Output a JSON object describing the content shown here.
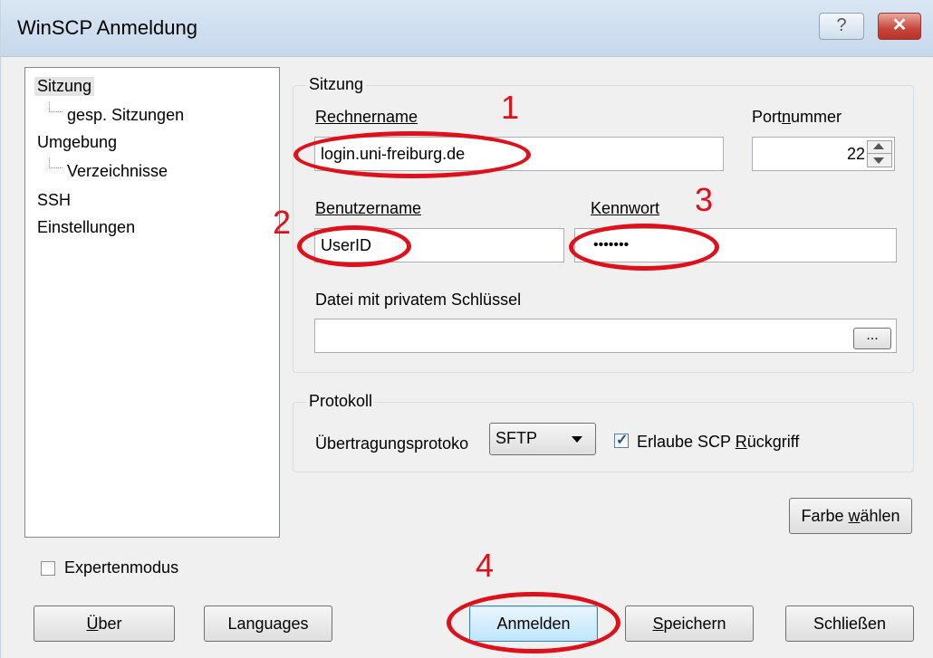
{
  "window": {
    "title": "WinSCP Anmeldung",
    "help_label": "?",
    "close_label": "✕"
  },
  "tree": {
    "items": [
      {
        "label": "Sitzung",
        "selected": true
      },
      {
        "label": "gesp. Sitzungen"
      },
      {
        "label": "Umgebung"
      },
      {
        "label": "Verzeichnisse"
      },
      {
        "label": "SSH"
      },
      {
        "label": "Einstellungen"
      }
    ]
  },
  "session": {
    "group_title": "Sitzung",
    "host_label": "Rechnername",
    "host_value": "login.uni-freiburg.de",
    "port_label": "Portnummer",
    "port_value": "22",
    "user_label": "Benutzername",
    "user_value": "UserID",
    "password_label": "Kennwort",
    "password_value": "•••••••",
    "keyfile_label": "Datei mit privatem Schlüssel",
    "keyfile_value": "",
    "browse_label": "..."
  },
  "protocol": {
    "group_title": "Protokoll",
    "transfer_label": "Übertragungsprotoko",
    "transfer_value": "SFTP",
    "scp_fallback_label": "Erlaube SCP Rückgriff",
    "scp_fallback_checked": true
  },
  "buttons": {
    "color": "Farbe wählen",
    "about": "Über",
    "languages": "Languages",
    "login": "Anmelden",
    "save": "Speichern",
    "close": "Schließen"
  },
  "expert_mode": {
    "label": "Expertenmodus",
    "checked": false
  },
  "annotations": {
    "marks": [
      "1",
      "2",
      "3",
      "4"
    ],
    "color": "#e0101a"
  }
}
